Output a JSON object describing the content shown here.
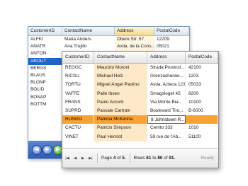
{
  "back_grid": {
    "columns": [
      "CustomerID",
      "ContactName",
      "Address",
      "PostalCode"
    ],
    "rows": [
      [
        "ALFKI",
        "Maria Anders",
        "Obere Str. 57",
        "12209"
      ],
      [
        "ANATR",
        "Ana Trujillo",
        "Avda. de la Cons...",
        "05021"
      ],
      [
        "ANTON",
        "",
        "",
        ""
      ],
      [
        "AROUT",
        "",
        "",
        ""
      ],
      [
        "BERGS",
        "",
        "",
        ""
      ],
      [
        "BLAUS",
        "",
        "",
        ""
      ],
      [
        "BLONP",
        "",
        "",
        ""
      ],
      [
        "BOLID",
        "",
        "",
        ""
      ],
      [
        "BONAP",
        "",
        "",
        ""
      ],
      [
        "BOTTM",
        "",
        "",
        ""
      ]
    ],
    "selected_row": 3,
    "highlighted_column": "Address",
    "pager_buttons": [
      "◀",
      "▶",
      "▶"
    ]
  },
  "front_grid": {
    "columns": [
      "CustomerID",
      "ContactName",
      "Address",
      "PostalCode"
    ],
    "rows": [
      [
        "REGGC",
        "Maurizio Moroni",
        "Strada Provinci...",
        "42100"
      ],
      [
        "RICSU",
        "Michael Holz",
        "Grenzacherwe...",
        "1203"
      ],
      [
        "TORTU",
        "Miguel Angel Paolino",
        "Avda. Azteca 123",
        "05033"
      ],
      [
        "VAFFE",
        "Palle Ibsen",
        "Smagsloget 45",
        "8200"
      ],
      [
        "FRANS",
        "Paolo Accorti",
        "Via Monte Bia...",
        "10100"
      ],
      [
        "SUPRD",
        "Pascale Cartrain",
        "Boulevard Tiro...",
        "B-6000"
      ],
      [
        "HUNGO",
        "Patricia McKenna",
        "8 Johnstown R...",
        ""
      ],
      [
        "CACTU",
        "Patricio Simpson",
        "Cerrito 333",
        "1010"
      ],
      [
        "VINET",
        "Paul Henriot",
        "59 rue de l'Ab...",
        "51100"
      ]
    ],
    "selected_row": 6,
    "pager": {
      "nav_buttons": [
        "|◀",
        "◀",
        "▶",
        "▶|"
      ],
      "page_label": "Page",
      "page_current": "4",
      "page_of": "of",
      "page_total": "5.",
      "rows_label": "Rows",
      "rows_from": "61",
      "rows_to_label": "to",
      "rows_to": "80",
      "rows_of": "of",
      "rows_total": "91.",
      "status": "Ready"
    }
  },
  "colors": {
    "back_selection": "#1f64c8",
    "back_pager": "#2e5cb3",
    "front_selection": "#f7a233",
    "front_sorted_column": "#fde9c8"
  }
}
